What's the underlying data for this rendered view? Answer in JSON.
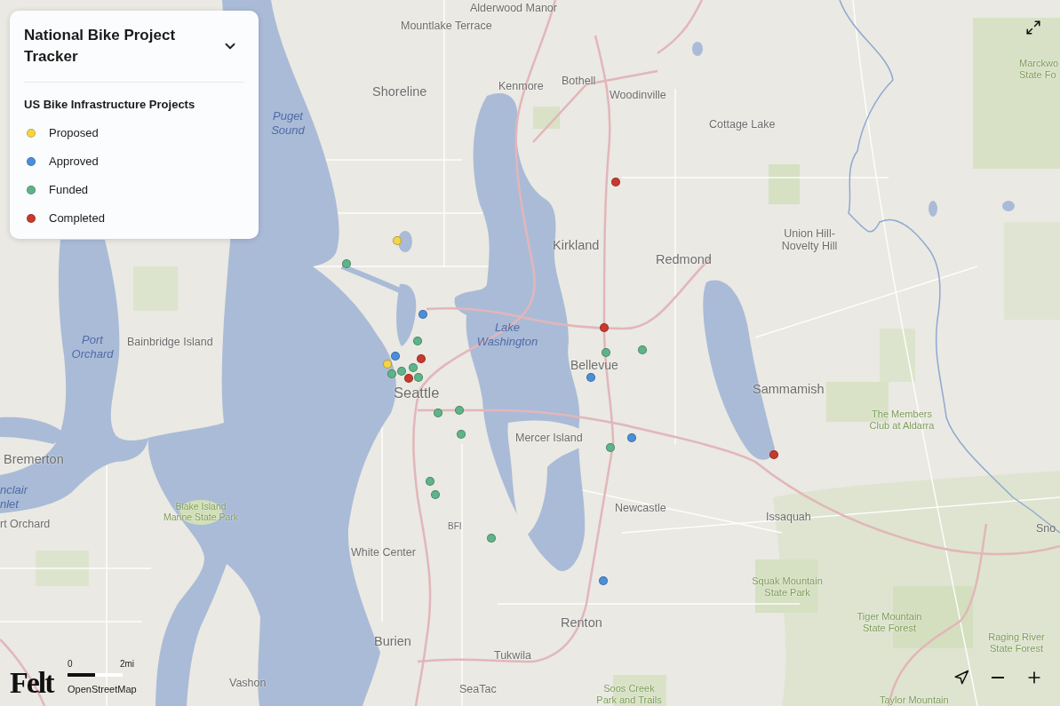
{
  "legend": {
    "title": "National Bike Project Tracker",
    "expanded": true,
    "layer_title": "US Bike Infrastructure Projects",
    "items": [
      {
        "label": "Proposed",
        "color": "#f3d548"
      },
      {
        "label": "Approved",
        "color": "#4b8fdb"
      },
      {
        "label": "Funded",
        "color": "#5fb388"
      },
      {
        "label": "Completed",
        "color": "#c73a2d"
      }
    ]
  },
  "map": {
    "labels": [
      {
        "text": "Alderwood Manor",
        "kind": "city"
      },
      {
        "text": "Mountlake Terrace",
        "kind": "city"
      },
      {
        "text": "Marckwo State Fo",
        "kind": "park"
      },
      {
        "text": "Bothell",
        "kind": "city"
      },
      {
        "text": "Kenmore",
        "kind": "city"
      },
      {
        "text": "Shoreline",
        "kind": "city"
      },
      {
        "text": "Woodinville",
        "kind": "city"
      },
      {
        "text": "Puget Sound",
        "kind": "water"
      },
      {
        "text": "Cottage Lake",
        "kind": "city"
      },
      {
        "text": "Kirkland",
        "kind": "city"
      },
      {
        "text": "Redmond",
        "kind": "city"
      },
      {
        "text": "Union Hill-Novelty Hill",
        "kind": "city"
      },
      {
        "text": "Lake Washington",
        "kind": "water"
      },
      {
        "text": "Port Orchard",
        "kind": "water"
      },
      {
        "text": "Bainbridge Island",
        "kind": "city"
      },
      {
        "text": "Bellevue",
        "kind": "city"
      },
      {
        "text": "Seattle",
        "kind": "city"
      },
      {
        "text": "Sammamish",
        "kind": "city"
      },
      {
        "text": "The Members Club at Aldarra",
        "kind": "park"
      },
      {
        "text": "Mercer Island",
        "kind": "city"
      },
      {
        "text": "Bremerton",
        "kind": "city"
      },
      {
        "text": "nclair nlet",
        "kind": "water"
      },
      {
        "text": "Blake Island Marine State Park",
        "kind": "park"
      },
      {
        "text": "Newcastle",
        "kind": "city"
      },
      {
        "text": "Issaquah",
        "kind": "city"
      },
      {
        "text": "rt Orchard",
        "kind": "city"
      },
      {
        "text": "BFI",
        "kind": "city"
      },
      {
        "text": "Sno",
        "kind": "city"
      },
      {
        "text": "White Center",
        "kind": "city"
      },
      {
        "text": "Squak Mountain State Park",
        "kind": "park"
      },
      {
        "text": "Renton",
        "kind": "city"
      },
      {
        "text": "Tiger Mountain State Forest",
        "kind": "park"
      },
      {
        "text": "Burien",
        "kind": "city"
      },
      {
        "text": "Tukwila",
        "kind": "city"
      },
      {
        "text": "Raging River State Forest",
        "kind": "park"
      },
      {
        "text": "Vashon",
        "kind": "city"
      },
      {
        "text": "SeaTac",
        "kind": "city"
      },
      {
        "text": "Soos Creek Park and Trails",
        "kind": "park"
      },
      {
        "text": "Taylor Mountain",
        "kind": "park"
      }
    ],
    "projects": [
      {
        "color": "#c73a2d"
      },
      {
        "color": "#f3d548"
      },
      {
        "color": "#5fb388"
      },
      {
        "color": "#4b8fdb"
      },
      {
        "color": "#c73a2d"
      },
      {
        "color": "#5fb388"
      },
      {
        "color": "#5fb388"
      },
      {
        "color": "#5fb388"
      },
      {
        "color": "#4b8fdb"
      },
      {
        "color": "#c73a2d"
      },
      {
        "color": "#5fb388"
      },
      {
        "color": "#f3d548"
      },
      {
        "color": "#5fb388"
      },
      {
        "color": "#5fb388"
      },
      {
        "color": "#4b8fdb"
      },
      {
        "color": "#c73a2d"
      },
      {
        "color": "#5fb388"
      },
      {
        "color": "#5fb388"
      },
      {
        "color": "#5fb388"
      },
      {
        "color": "#5fb388"
      },
      {
        "color": "#4b8fdb"
      },
      {
        "color": "#5fb388"
      },
      {
        "color": "#c73a2d"
      },
      {
        "color": "#5fb388"
      },
      {
        "color": "#5fb388"
      },
      {
        "color": "#5fb388"
      },
      {
        "color": "#4b8fdb"
      }
    ]
  },
  "scale": {
    "start": "0",
    "end": "2mi"
  },
  "attribution": "OpenStreetMap",
  "logo": "Felt"
}
